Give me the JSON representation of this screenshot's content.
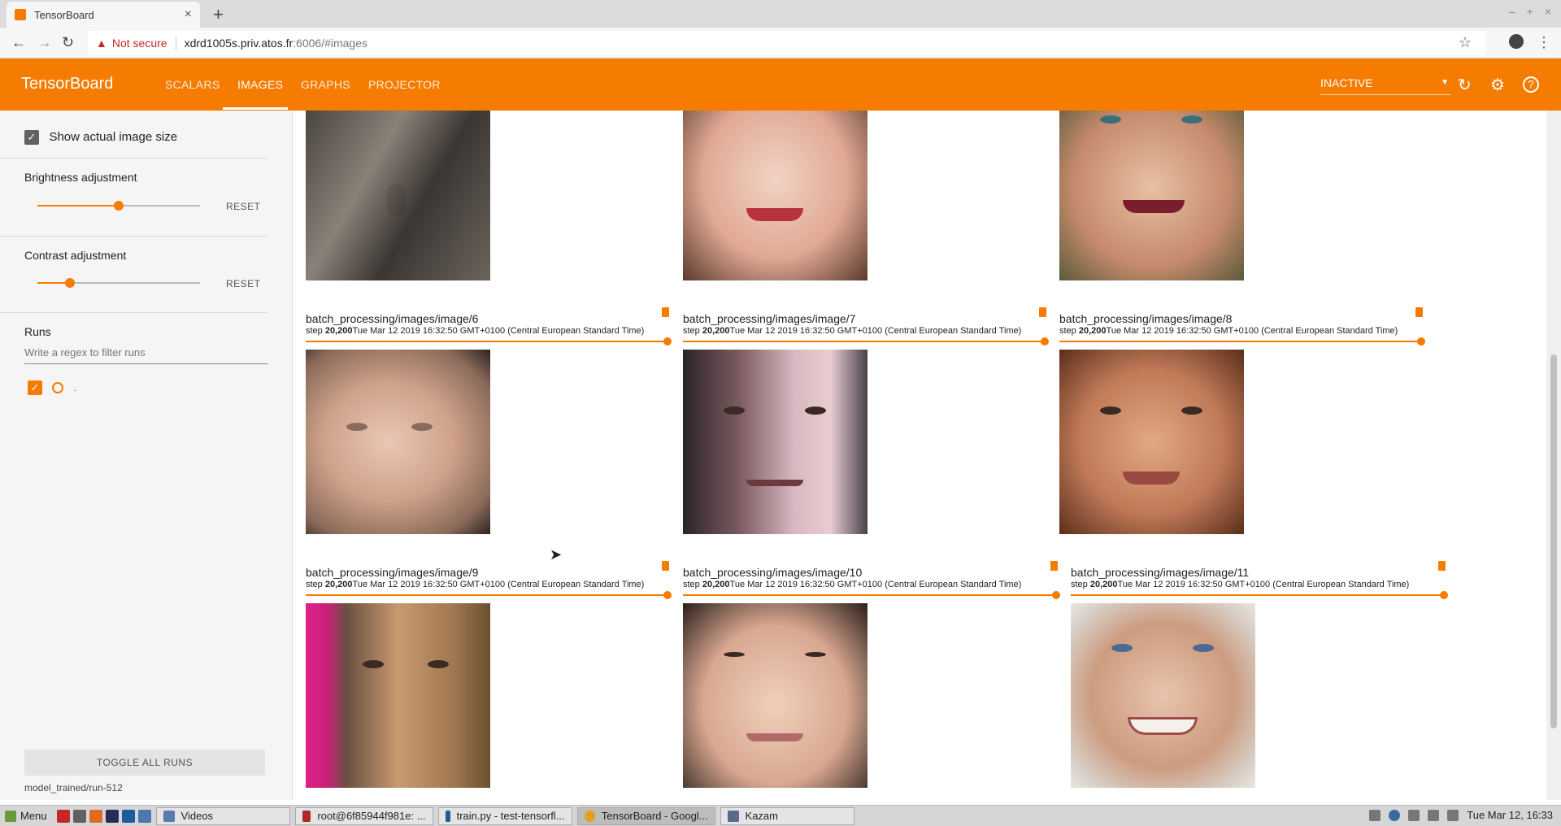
{
  "browser": {
    "tab_title": "TensorBoard",
    "tab_close": "×",
    "new_tab": "+",
    "security_label": "Not secure",
    "url_host": "xdrd1005s.priv.atos.fr",
    "url_rest": ":6006/#images",
    "window_controls": [
      "–",
      "+",
      "×"
    ]
  },
  "header": {
    "brand": "TensorBoard",
    "tabs": [
      "SCALARS",
      "IMAGES",
      "GRAPHS",
      "PROJECTOR"
    ],
    "active_tab": "IMAGES",
    "run_status": "INACTIVE"
  },
  "sidebar": {
    "show_actual_size_label": "Show actual image size",
    "brightness_label": "Brightness adjustment",
    "brightness_value": 0.5,
    "contrast_label": "Contrast adjustment",
    "contrast_value": 0.2,
    "reset_label": "RESET",
    "runs_label": "Runs",
    "filter_placeholder": "Write a regex to filter runs",
    "run_name": ".",
    "toggle_all_label": "TOGGLE ALL RUNS",
    "run_path": "model_trained/run-512"
  },
  "images": [
    {
      "title": "batch_processing/images/image/6",
      "step_prefix": "step ",
      "step": "20,200",
      "time": "Tue Mar 12 2019 16:32:50 GMT+0100 (Central European Standard Time)"
    },
    {
      "title": "batch_processing/images/image/7",
      "step_prefix": "step ",
      "step": "20,200",
      "time": "Tue Mar 12 2019 16:32:50 GMT+0100 (Central European Standard Time)"
    },
    {
      "title": "batch_processing/images/image/8",
      "step_prefix": "step ",
      "step": "20,200",
      "time": "Tue Mar 12 2019 16:32:50 GMT+0100 (Central European Standard Time)"
    },
    {
      "title": "batch_processing/images/image/9",
      "step_prefix": "step ",
      "step": "20,200",
      "time": "Tue Mar 12 2019 16:32:50 GMT+0100 (Central European Standard Time)"
    },
    {
      "title": "batch_processing/images/image/10",
      "step_prefix": "step ",
      "step": "20,200",
      "time": "Tue Mar 12 2019 16:32:50 GMT+0100 (Central European Standard Time)"
    },
    {
      "title": "batch_processing/images/image/11",
      "step_prefix": "step ",
      "step": "20,200",
      "time": "Tue Mar 12 2019 16:32:50 GMT+0100 (Central European Standard Time)"
    }
  ],
  "taskbar": {
    "menu_label": "Menu",
    "items": [
      "Videos",
      "root@6f85944f981e: ...",
      "train.py - test-tensorfl...",
      "TensorBoard - Googl...",
      "Kazam"
    ],
    "active_item": "TensorBoard - Googl...",
    "clock": "Tue Mar 12, 16:33"
  },
  "colors": {
    "accent": "#f57c00",
    "header_bg": "#f57c00",
    "sidebar_bg": "#f5f5f5"
  }
}
